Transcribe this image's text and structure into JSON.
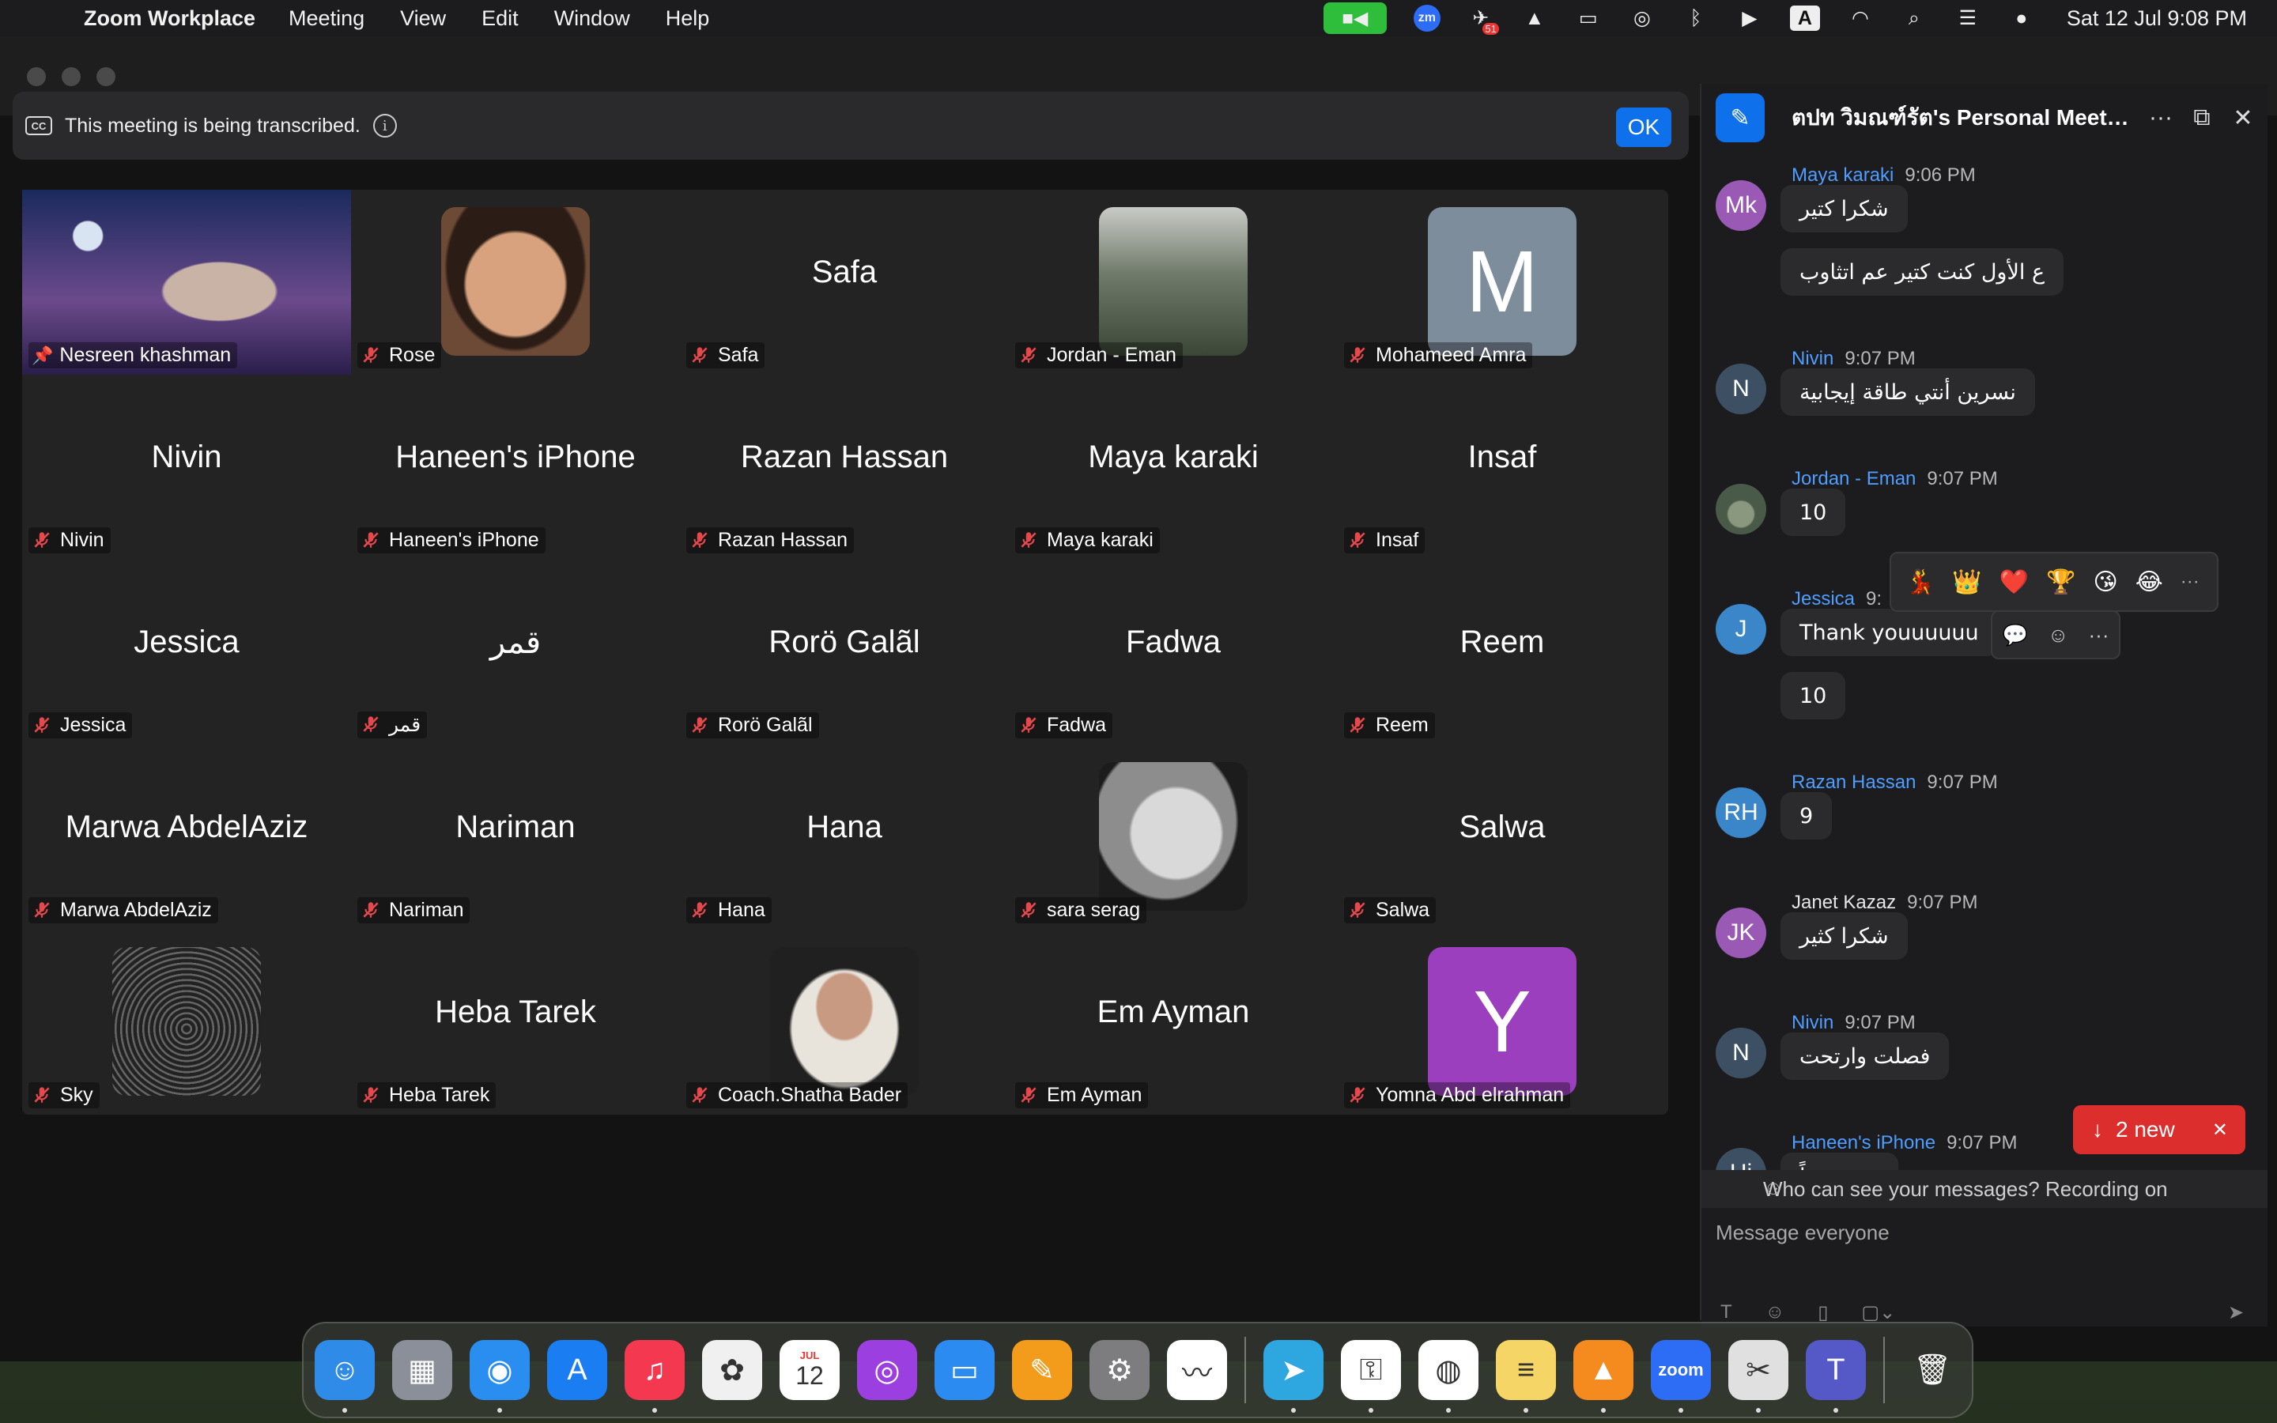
{
  "menubar": {
    "app_name": "Zoom Workplace",
    "menus": [
      "Meeting",
      "View",
      "Edit",
      "Window",
      "Help"
    ],
    "clock": "Sat 12 Jul  9:08 PM",
    "notification_count": "51",
    "keyboard_label": "A"
  },
  "banner": {
    "cc_label": "CC",
    "text": "This meeting is being transcribed.",
    "ok_label": "OK"
  },
  "gallery": {
    "tiles": [
      {
        "label": "Nesreen khashman",
        "big": "",
        "pinned": true,
        "active": true,
        "thumb": "video-nesreen"
      },
      {
        "label": "Rose",
        "big": "",
        "thumb": "photo-rose"
      },
      {
        "label": "Safa",
        "big": "Safa"
      },
      {
        "label": "Jordan - Eman",
        "big": "",
        "thumb": "photo-trees"
      },
      {
        "label": "Mohameed Amra",
        "big": "",
        "thumb": "letter",
        "letter": "M",
        "color": "#7e8d9b"
      },
      {
        "label": "Nivin",
        "big": "Nivin"
      },
      {
        "label": "Haneen's iPhone",
        "big": "Haneen's iPhone"
      },
      {
        "label": "Razan Hassan",
        "big": "Razan Hassan"
      },
      {
        "label": "Maya karaki",
        "big": "Maya karaki"
      },
      {
        "label": "Insaf",
        "big": "Insaf"
      },
      {
        "label": "Jessica",
        "big": "Jessica"
      },
      {
        "label": "قمر",
        "big": "قمر"
      },
      {
        "label": "Rorö Galãl",
        "big": "Rorö Galãl"
      },
      {
        "label": "Fadwa",
        "big": "Fadwa"
      },
      {
        "label": "Reem",
        "big": "Reem"
      },
      {
        "label": "Marwa AbdelAziz",
        "big": "Marwa AbdelAziz"
      },
      {
        "label": "Nariman",
        "big": "Nariman"
      },
      {
        "label": "Hana",
        "big": "Hana"
      },
      {
        "label": "sara serag",
        "big": "",
        "thumb": "photo-sara"
      },
      {
        "label": "Salwa",
        "big": "Salwa"
      },
      {
        "label": "Sky",
        "big": "",
        "thumb": "photo-sky"
      },
      {
        "label": "Heba Tarek",
        "big": "Heba Tarek"
      },
      {
        "label": "Coach.Shatha Bader",
        "big": "",
        "thumb": "photo-shatha"
      },
      {
        "label": "Em Ayman",
        "big": "Em Ayman"
      },
      {
        "label": "Yomna Abd elrahman",
        "big": "",
        "thumb": "letter",
        "letter": "Y",
        "color": "#9b3fbf"
      }
    ]
  },
  "chat": {
    "title": "ตปท วิมณฑ์รัต's Personal Meeting...",
    "messages": [
      {
        "initials": "Mk",
        "avatar_color": "#9b59b6",
        "sender": "Maya karaki",
        "time": "9:06 PM",
        "bubbles": [
          "شكرا كتير",
          "ع الأول كنت كتير عم اتثاوب"
        ]
      },
      {
        "initials": "N",
        "avatar_color": "#3d4f63",
        "sender": "Nivin",
        "time": "9:07 PM",
        "bubbles": [
          "نسرين أنتي طاقة إيجابية"
        ]
      },
      {
        "initials": "",
        "avatar_color": "#4a5a48",
        "sender": "Jordan - Eman",
        "time": "9:07 PM",
        "bubbles": [
          "10"
        ]
      },
      {
        "initials": "J",
        "avatar_color": "#3a86c8",
        "sender": "Jessica",
        "time": "9:",
        "bubbles": [
          "Thank youuuuuu",
          "10"
        ]
      },
      {
        "initials": "RH",
        "avatar_color": "#3a86c8",
        "sender": "Razan Hassan",
        "time": "9:07 PM",
        "bubbles": [
          "9"
        ]
      },
      {
        "initials": "JK",
        "avatar_color": "#9b59b6",
        "sender": "Janet Kazaz",
        "time": "9:07 PM",
        "plain": true,
        "bubbles": [
          "شكرا كثير"
        ]
      },
      {
        "initials": "N",
        "avatar_color": "#3d4f63",
        "sender": "Nivin",
        "time": "9:07 PM",
        "bubbles": [
          "فصلت وارتحت"
        ]
      },
      {
        "initials": "Hi",
        "avatar_color": "#3d4f63",
        "sender": "Haneen's iPhone",
        "time": "9:07 PM",
        "bubbles": [
          "مريح جداً"
        ]
      }
    ],
    "reactions": [
      "💃",
      "👑",
      "❤️",
      "🏆",
      "😘",
      "😂"
    ],
    "new_messages_label": "2 new",
    "privacy_text": "Who can see your messages? Recording on",
    "input_placeholder": "Message everyone"
  },
  "dock": {
    "apps": [
      {
        "name": "finder-icon",
        "glyph": "☺",
        "color": "#2f8be8",
        "running": true
      },
      {
        "name": "launchpad-icon",
        "glyph": "▦",
        "color": "#8a8f99",
        "running": false
      },
      {
        "name": "safari-icon",
        "glyph": "◉",
        "color": "#2a8ef0",
        "running": true
      },
      {
        "name": "app-store-icon",
        "glyph": "A",
        "color": "#1a7ef2",
        "running": false
      },
      {
        "name": "music-icon",
        "glyph": "♫",
        "color": "#f3384f",
        "running": true
      },
      {
        "name": "photos-icon",
        "glyph": "✿",
        "color": "#f0f0f0",
        "running": false
      },
      {
        "name": "calendar-icon",
        "glyph": "12",
        "color": "#ffffff",
        "running": false,
        "sub": "JUL"
      },
      {
        "name": "podcasts-icon",
        "glyph": "◎",
        "color": "#9b3fe0",
        "running": false
      },
      {
        "name": "keynote-icon",
        "glyph": "▭",
        "color": "#2b8bf0",
        "running": false
      },
      {
        "name": "pages-icon",
        "glyph": "✎",
        "color": "#f39c1c",
        "running": false
      },
      {
        "name": "system-settings-icon",
        "glyph": "⚙",
        "color": "#7d7d80",
        "running": false
      },
      {
        "name": "freeform-icon",
        "glyph": "〰",
        "color": "#ffffff",
        "running": false
      },
      {
        "name": "separator",
        "glyph": "",
        "color": "",
        "running": false
      },
      {
        "name": "telegram-icon",
        "glyph": "➤",
        "color": "#2ea6e0",
        "running": true
      },
      {
        "name": "passwords-icon",
        "glyph": "⚿",
        "color": "#ffffff",
        "running": true
      },
      {
        "name": "chrome-icon",
        "glyph": "◍",
        "color": "#ffffff",
        "running": true
      },
      {
        "name": "notes-icon",
        "glyph": "≡",
        "color": "#f5d565",
        "running": true
      },
      {
        "name": "vlc-icon",
        "glyph": "▲",
        "color": "#f58a1f",
        "running": true
      },
      {
        "name": "zoom-icon",
        "glyph": "zoom",
        "color": "#2d6df6",
        "running": true
      },
      {
        "name": "system-toolkit-icon",
        "glyph": "✂",
        "color": "#e0e0e0",
        "running": true
      },
      {
        "name": "teams-icon",
        "glyph": "T",
        "color": "#5558c7",
        "running": true
      },
      {
        "name": "separator",
        "glyph": "",
        "color": "",
        "running": false
      },
      {
        "name": "trash-icon",
        "glyph": "🗑",
        "color": "transparent",
        "running": false
      }
    ]
  }
}
